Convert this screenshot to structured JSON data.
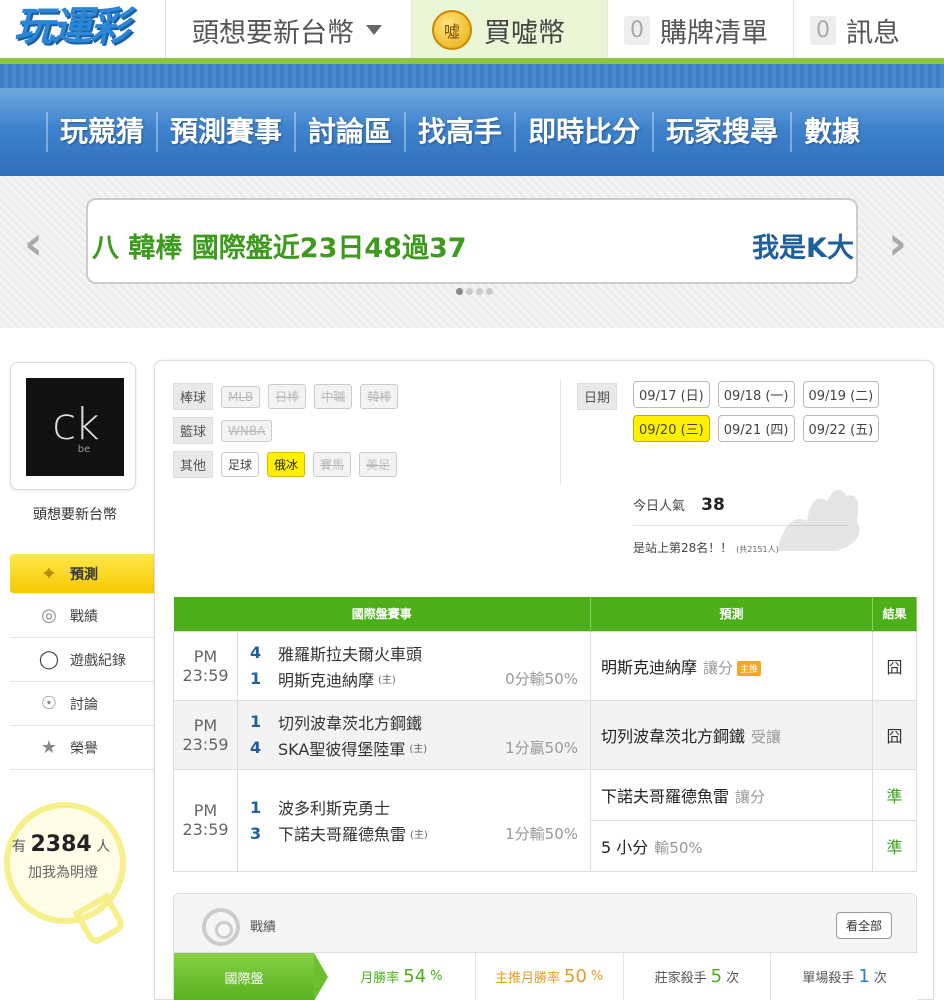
{
  "header": {
    "logo_text": "玩運彩",
    "user_menu": "頭想要新台幣",
    "coin_icon_label": "噓",
    "buy_label": "買噓幣",
    "cart_count": "0",
    "cart_label": "購牌清單",
    "msg_count": "0",
    "msg_label": "訊息"
  },
  "nav": {
    "items": [
      "玩競猜",
      "預測賽事",
      "討論區",
      "找高手",
      "即時比分",
      "玩家搜尋",
      "數據"
    ]
  },
  "banner": {
    "ticker_left": "八 韓棒 國際盤近23日48過37",
    "ticker_right": "我是K大",
    "prev_icon": "chevron-left-icon",
    "next_icon": "chevron-right-icon"
  },
  "profile": {
    "avatar_text": "ck",
    "avatar_sub": "be",
    "name": "頭想要新台幣"
  },
  "side_menu": {
    "items": [
      {
        "label": "預測",
        "icon": "target-icon",
        "active": true
      },
      {
        "label": "戰績",
        "icon": "record-icon",
        "active": false
      },
      {
        "label": "遊戲紀錄",
        "icon": "circle-icon",
        "active": false
      },
      {
        "label": "討論",
        "icon": "discuss-icon",
        "active": false
      },
      {
        "label": "榮譽",
        "icon": "medal-icon",
        "active": false
      }
    ]
  },
  "lamp": {
    "prefix": "有",
    "count": "2384",
    "suffix": "人",
    "caption": "加我為明燈"
  },
  "filters": {
    "baseball_label": "棒球",
    "baseball": [
      "MLB",
      "日棒",
      "中職",
      "韓棒"
    ],
    "basketball_label": "籃球",
    "basketball": [
      "WNBA"
    ],
    "other_label": "其他",
    "other": [
      "足球",
      "俄冰",
      "賽馬",
      "美足"
    ],
    "date_label": "日期",
    "dates_row1": [
      "09/17 (日)",
      "09/18 (一)",
      "09/19 (二)"
    ],
    "dates_row2": [
      "09/20 (三)",
      "09/21 (四)",
      "09/22 (五)"
    ]
  },
  "popularity": {
    "label": "今日人氣",
    "value": "38",
    "rank_text": "是站上第28名！！",
    "rank_total": "(共2151人)"
  },
  "table": {
    "headers": [
      "國際盤賽事",
      "預測",
      "結果"
    ],
    "host_tag": "(主)",
    "matches": [
      {
        "time": "PM 23:59",
        "team1_num": "4",
        "team1": "雅羅斯拉夫爾火車頭",
        "team2_num": "1",
        "team2": "明斯克迪納摩",
        "team2_odds": "0分輸50%",
        "picks": [
          {
            "team": "明斯克迪納摩",
            "type": "讓分",
            "badge": "主推",
            "result": "囧"
          }
        ]
      },
      {
        "time": "PM 23:59",
        "team1_num": "1",
        "team1": "切列波韋茨北方鋼鐵",
        "team2_num": "4",
        "team2": "SKA聖彼得堡陸軍",
        "team2_odds": "1分贏50%",
        "picks": [
          {
            "team": "切列波韋茨北方鋼鐵",
            "type": "受讓",
            "result": "囧"
          }
        ]
      },
      {
        "time": "PM 23:59",
        "team1_num": "1",
        "team1": "波多利斯克勇士",
        "team2_num": "3",
        "team2": "下諾夫哥羅德魚雷",
        "team2_odds": "1分輸50%",
        "picks": [
          {
            "team": "下諾夫哥羅德魚雷",
            "type": "讓分",
            "result": "準"
          },
          {
            "team": "5 小分",
            "type": "輸50%",
            "result": "準"
          }
        ]
      }
    ]
  },
  "record": {
    "title": "戰績",
    "see_all": "看全部",
    "tab": "國際盤",
    "stats": [
      {
        "label": "月勝率",
        "value": "54",
        "unit": "%"
      },
      {
        "label": "主推月勝率",
        "value": "50",
        "unit": "%"
      },
      {
        "label": "莊家殺手",
        "value": "5",
        "unit": "次"
      },
      {
        "label": "單場殺手",
        "value": "1",
        "unit": "次"
      }
    ]
  },
  "colors": {
    "nav_blue": "#3f82cc",
    "green": "#4caf1a",
    "yellow": "#fff000",
    "orange": "#e89a28"
  }
}
